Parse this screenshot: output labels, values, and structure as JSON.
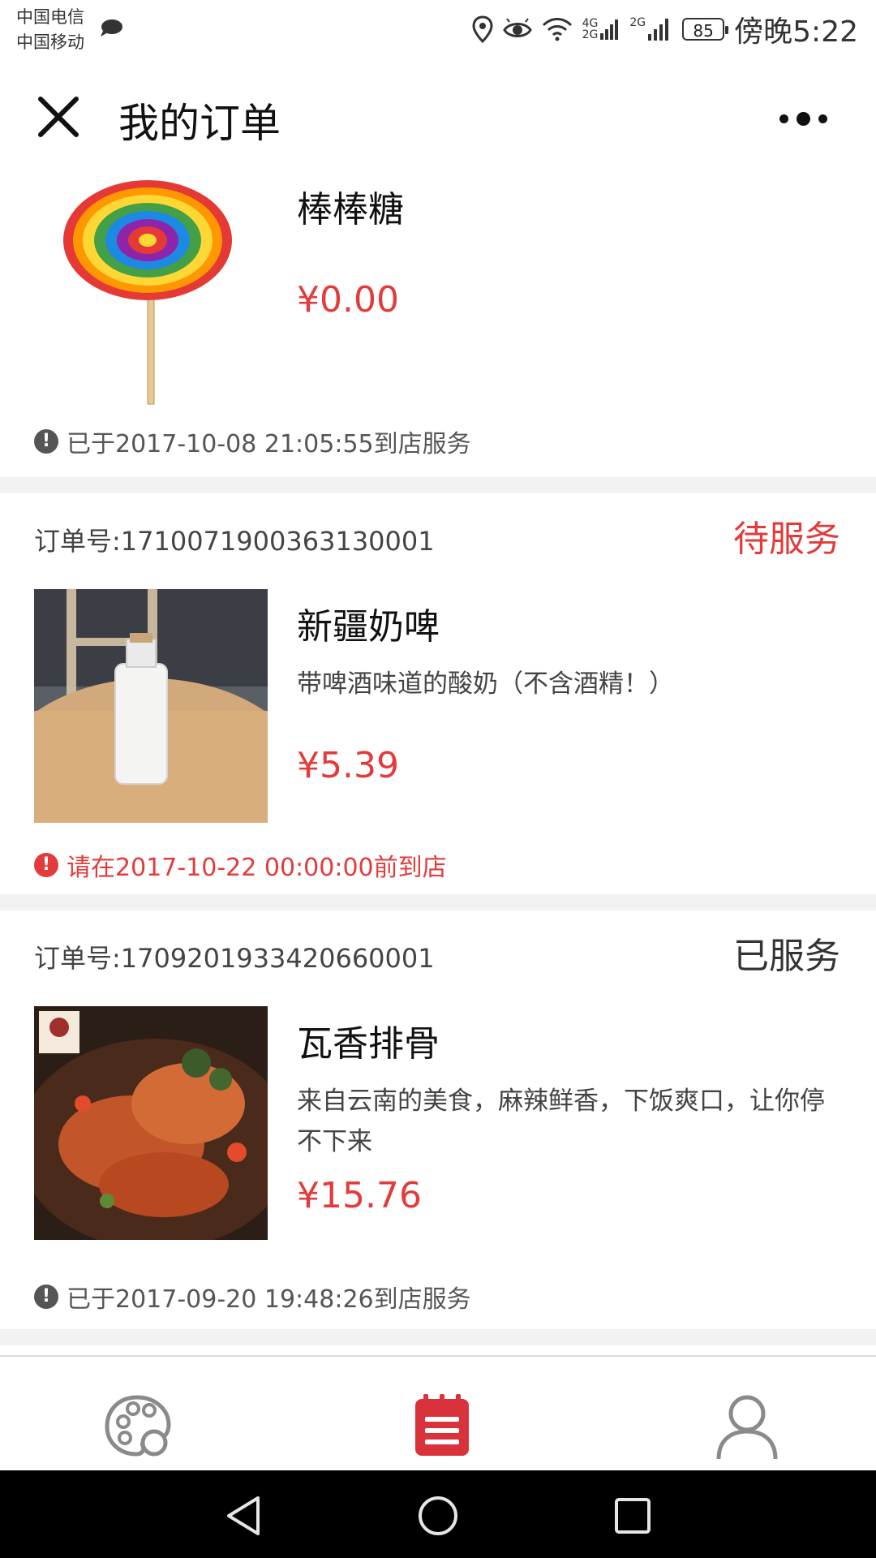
{
  "status_bar": {
    "carrier1": "中国电信",
    "carrier2": "中国移动",
    "net1": "4G",
    "net2": "2G",
    "battery": "85",
    "time": "傍晚5:22"
  },
  "header": {
    "title": "我的订单"
  },
  "orders": [
    {
      "name": "棒棒糖",
      "price": "¥0.00",
      "note": "已于2017-10-08 21:05:55到店服务"
    },
    {
      "order_no": "订单号:1710071900363130001",
      "status": "待服务",
      "name": "新疆奶啤",
      "desc": "带啤酒味道的酸奶（不含酒精！）",
      "price": "¥5.39",
      "note": "请在2017-10-22 00:00:00前到店"
    },
    {
      "order_no": "订单号:1709201933420660001",
      "status": "已服务",
      "name": "瓦香排骨",
      "desc": "来自云南的美食，麻辣鲜香，下饭爽口，让你停不下来",
      "price": "¥15.76",
      "note": "已于2017-09-20 19:48:26到店服务"
    }
  ],
  "colors": {
    "accent_red": "#e33b3b",
    "tab_active": "#d8323a",
    "tab_inactive": "#8a8a8a"
  },
  "icons": {
    "close": "close-icon",
    "more": "more-icon",
    "tab1": "palette-icon",
    "tab2": "orders-icon",
    "tab3": "user-icon"
  }
}
